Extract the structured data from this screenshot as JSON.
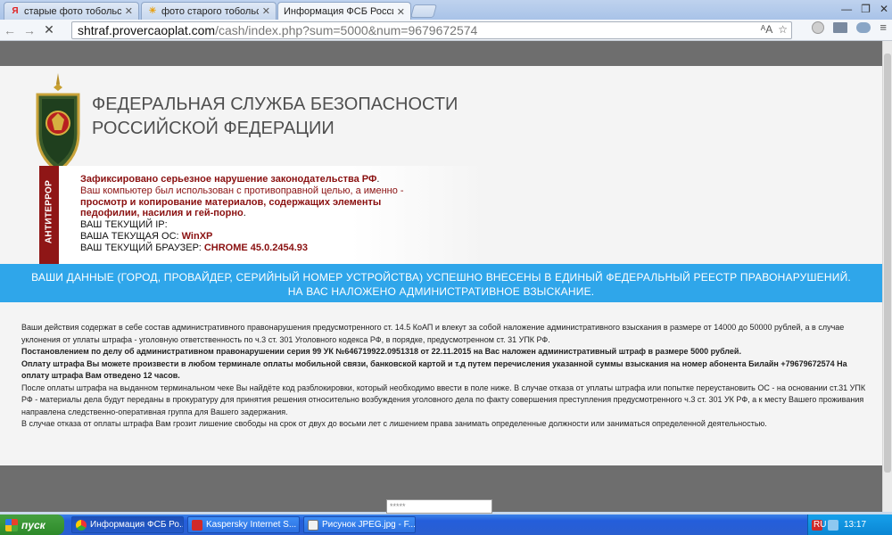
{
  "browser": {
    "tabs": [
      {
        "favicon": "yandex-icon",
        "favicon_glyph": "Я",
        "title": "старые фото тобольска —"
      },
      {
        "favicon": "sun-icon",
        "favicon_glyph": "☀",
        "title": "фото старого тобольска - Я"
      },
      {
        "favicon": "page-icon",
        "favicon_glyph": "",
        "title": "Информация ФСБ России ::"
      }
    ],
    "url_host": "shtraf.provercaoplat.com",
    "url_path": "/cash/index.php?sum=5000&num=9679672574",
    "back_glyph": "←",
    "forward_glyph": "→",
    "stop_glyph": "✕",
    "translate_glyph": "ᴬA",
    "star_glyph": "☆"
  },
  "page": {
    "agency_line1": "ФЕДЕРАЛЬНАЯ СЛУЖБА БЕЗОПАСНОСТИ",
    "agency_line2": "РОССИЙСКОЙ ФЕДЕРАЦИИ",
    "stripe_label": "АНТИТЕРРОР",
    "alert": {
      "headline": "Зафиксировано серьезное нарушение законодательства РФ",
      "line2": "Ваш компьютер был использован с противоправной целью, а именно -",
      "line3": "просмотр и копирование материалов, содержащих элементы",
      "line4": "педофилии, насилия и гей-порно",
      "ip_label": "ВАШ ТЕКУЩИЙ IP:",
      "os_label": "ВАША ТЕКУЩАЯ ОС:",
      "os_value": "WinXP",
      "browser_label": "ВАШ ТЕКУЩИЙ БРАУЗЕР:",
      "browser_value": "CHROME 45.0.2454.93"
    },
    "banner_line1": "ВАШИ ДАННЫЕ (ГОРОД, ПРОВАЙДЕР, СЕРИЙНЫЙ НОМЕР УСТРОЙСТВА) УСПЕШНО ВНЕСЕНЫ В ЕДИНЫЙ ФЕДЕРАЛЬНЫЙ РЕЕСТР ПРАВОНАРУШЕНИЙ.",
    "banner_line2": "НА ВАС НАЛОЖЕНО АДМИНИСТРАТИВНОЕ ВЗЫСКАНИЕ.",
    "para1": "Ваши действия содержат в себе состав административного правонарушения предусмотренного ст. 14.5 КоАП и влекут за собой наложение административного взыскания в размере от 14000 до 50000 рублей, а в случае уклонения от уплаты штрафа - уголовную ответственность по ч.3 ст. 301 Уголовного кодекса РФ, в порядке, предусмотренном ст. 31 УПК РФ.",
    "para2": "Постановлением по делу об административном правонарушении серия 99 УК №646719922.0951318 от 22.11.2015 на Вас наложен административный штраф в размере 5000 рублей.",
    "para3": "Оплату штрафа Вы можете произвести в любом терминале оплаты мобильной связи, банковской картой и т.д путем перечисления указанной суммы взыскания на номер абонента Билайн +79679672574 На оплату штрафа Вам отведено 12 часов.",
    "para4": "После оплаты штрафа на выданном терминальном чеке Вы найдёте код разблокировки, который необходимо ввести в поле ниже. В случае отказа от уплаты штрафа или попытке переустановить ОС - на основании ст.31 УПК РФ - материалы дела будут переданы в прокуратуру для принятия решения относительно возбуждения уголовного дела по факту совершения преступления предусмотренного ч.3 ст. 301 УК РФ, а к месту Вашего проживания направлена следственно-оперативная группа для Вашего задержания.",
    "para5": "В случае отказа от оплаты штрафа Вам грозит лишение свободы на срок от двух до восьми лет с лишением права занимать определенные должности или заниматься определенной деятельностью.",
    "code_input_value": "*****"
  },
  "taskbar": {
    "start_label": "пуск",
    "tasks": [
      {
        "icon": "chrome-icon",
        "color": "#e8b41a",
        "label": "Информация ФСБ Ро..."
      },
      {
        "icon": "kaspersky-icon",
        "color": "#d02a2a",
        "label": "Kaspersky Internet S..."
      },
      {
        "icon": "paint-icon",
        "color": "#f2f2f2",
        "label": "Рисунок JPEG.jpg - F..."
      }
    ],
    "language": "RU",
    "clock": "13:17"
  },
  "colors": {
    "banner": "#2fa6ea",
    "stripe": "#8f1616",
    "alert_red": "#8a1010"
  }
}
